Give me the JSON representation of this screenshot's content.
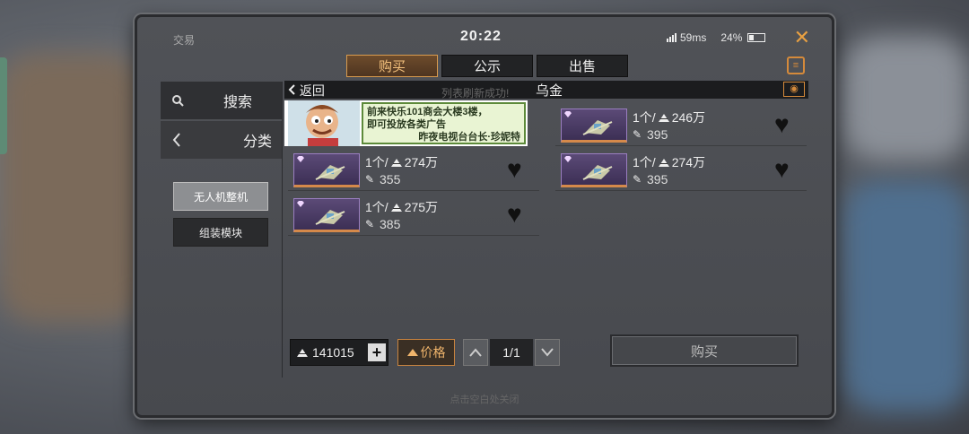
{
  "colors": {
    "accent": "#d99b4e",
    "panel": "#47494e",
    "dark_bar": "#1b1c1e"
  },
  "header": {
    "game_title": "交易",
    "clock": "20:22",
    "ping": "59ms",
    "battery": "24%"
  },
  "tabs": [
    {
      "label": "购买",
      "active": true
    },
    {
      "label": "公示",
      "active": false
    },
    {
      "label": "出售",
      "active": false
    }
  ],
  "sidebar": {
    "search_label": "搜索",
    "category_label": "分类",
    "subcategories": [
      {
        "label": "无人机整机",
        "selected": true
      },
      {
        "label": "组装模块",
        "selected": false
      }
    ]
  },
  "listbar": {
    "back_label": "返回",
    "refresh_message": "列表刷新成功!",
    "current_category": "乌金"
  },
  "ad": {
    "line1": "前来快乐101商会大楼3楼，",
    "line2": "即可投放各类广告",
    "line3": "昨夜电视台台长·珍妮特"
  },
  "listings": [
    {
      "quantity": "1个/",
      "unit_price": "274万",
      "price": "355"
    },
    {
      "quantity": "1个/",
      "unit_price": "275万",
      "price": "385"
    },
    {
      "quantity": "1个/",
      "unit_price": "246万",
      "price": "395"
    },
    {
      "quantity": "1个/",
      "unit_price": "274万",
      "price": "395"
    }
  ],
  "footer": {
    "balance": "141015",
    "sort_label": "价格",
    "page": "1/1",
    "buy_label": "购买",
    "hint": "点击空白处关闭"
  },
  "icons": [
    "close-icon",
    "clipboard-icon",
    "search-icon",
    "chevron-left-icon",
    "eye-icon",
    "heart-icon",
    "ore-icon",
    "currency-icon",
    "plus-icon",
    "arrow-up-icon",
    "arrow-down-icon"
  ]
}
